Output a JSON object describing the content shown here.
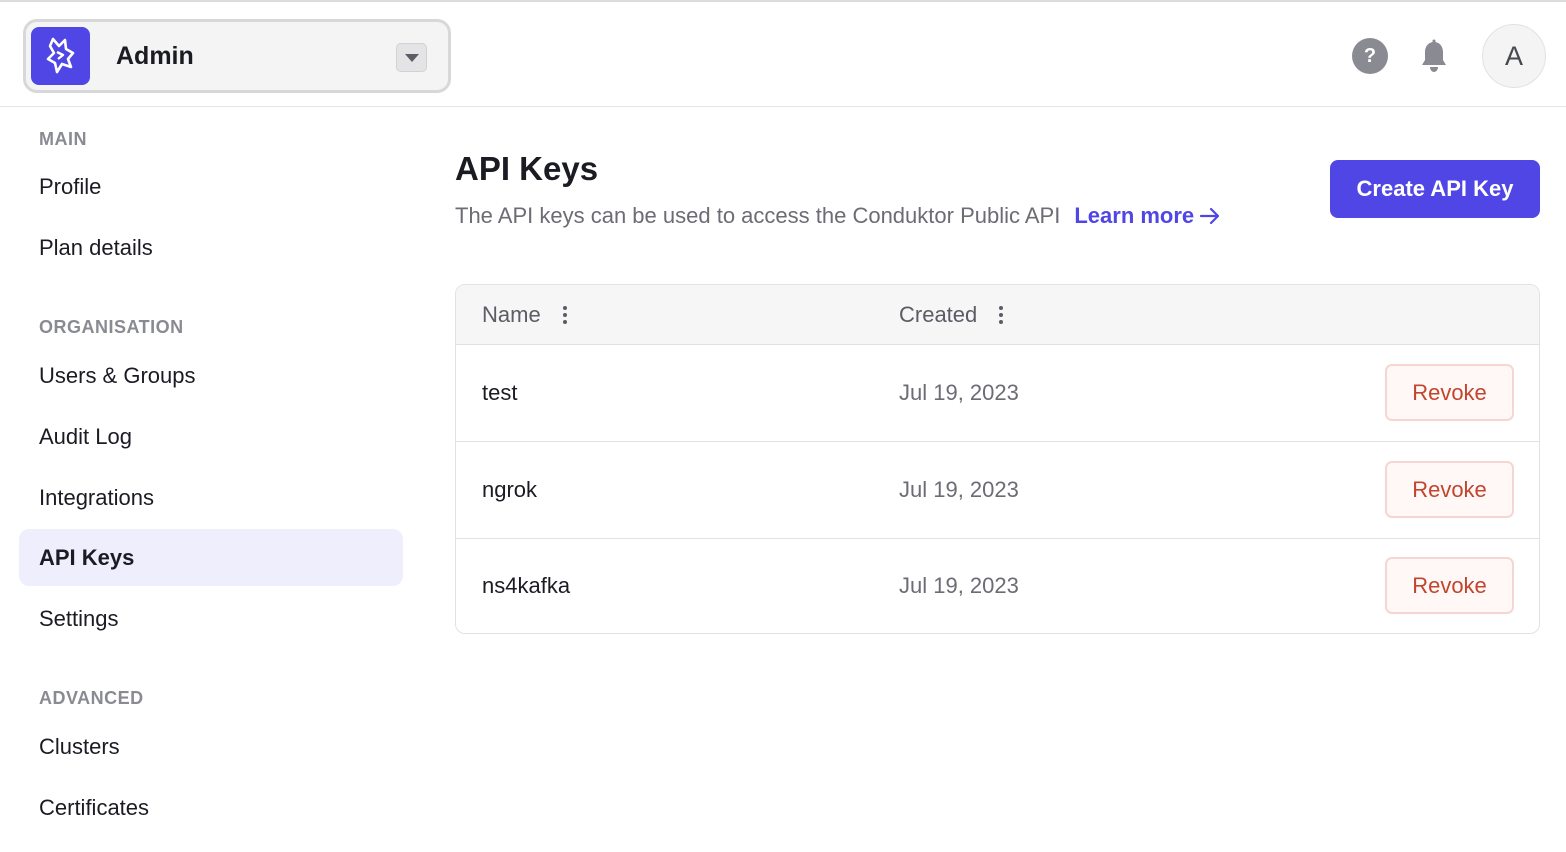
{
  "header": {
    "org_name": "Admin",
    "help_glyph": "?",
    "avatar_initial": "A",
    "accent_color": "#4f46e5"
  },
  "sidebar": {
    "sections": [
      {
        "title": "MAIN",
        "items": [
          {
            "label": "Profile"
          },
          {
            "label": "Plan details"
          }
        ]
      },
      {
        "title": "ORGANISATION",
        "items": [
          {
            "label": "Users & Groups"
          },
          {
            "label": "Audit Log"
          },
          {
            "label": "Integrations"
          },
          {
            "label": "API Keys",
            "active": true
          },
          {
            "label": "Settings"
          }
        ]
      },
      {
        "title": "ADVANCED",
        "items": [
          {
            "label": "Clusters"
          },
          {
            "label": "Certificates"
          }
        ]
      }
    ]
  },
  "main": {
    "title": "API Keys",
    "description": "The API keys can be used to access the Conduktor Public API",
    "learn_more": "Learn more",
    "create_button": "Create API Key",
    "table": {
      "columns": [
        "Name",
        "Created"
      ],
      "rows": [
        {
          "name": "test",
          "created": "Jul 19, 2023",
          "action": "Revoke"
        },
        {
          "name": "ngrok",
          "created": "Jul 19, 2023",
          "action": "Revoke"
        },
        {
          "name": "ns4kafka",
          "created": "Jul 19, 2023",
          "action": "Revoke"
        }
      ]
    }
  }
}
